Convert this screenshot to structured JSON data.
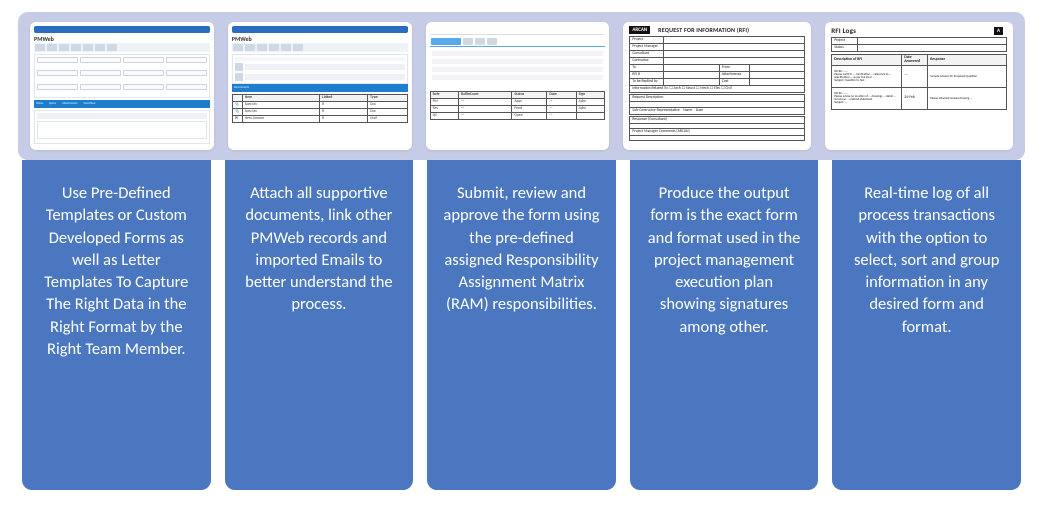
{
  "thumbnails": {
    "app_name": "PMWeb",
    "doc1_logo": "ARCAN",
    "doc1_title": "REQUEST FOR INFORMATION (RFI)",
    "doc2_title": "RFI Logs",
    "doc2_logo": "A"
  },
  "captions": [
    "Use Pre-Defined Templates or Custom Developed Forms as well as Letter Templates To Capture The Right Data in the Right Format by the Right Team Member.",
    "Attach all supportive documents, link other PMWeb records and imported Emails to better understand the process.",
    "Submit, review and approve the form using the pre-defined assigned Responsibility Assignment Matrix (RAM) responsibilities.",
    "Produce the output form is the exact form and format used in the project management execution plan showing signatures among other.",
    "Real-time log of all process transactions with the option to select, sort and group information in any desired form and format."
  ]
}
